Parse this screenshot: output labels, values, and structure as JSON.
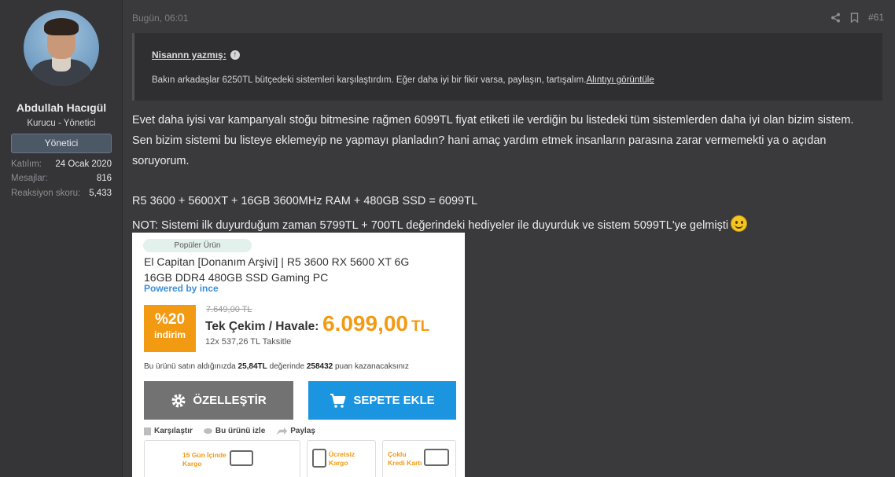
{
  "user": {
    "name": "Abdullah Hacıgül",
    "title": "Kurucu - Yönetici",
    "banner": "Yönetici",
    "stats": [
      {
        "label": "Katılım:",
        "value": "24 Ocak 2020"
      },
      {
        "label": "Mesajlar:",
        "value": "816"
      },
      {
        "label": "Reaksiyon skoru:",
        "value": "5,433"
      }
    ]
  },
  "post": {
    "time": "Bugün, 06:01",
    "number": "#61",
    "quote": {
      "author": "Nisannn yazmış:",
      "text": "Bakın arkadaşlar 6250TL bütçedeki sistemleri karşılaştırdım. Eğer daha iyi bir fikir varsa, paylaşın, tartışalım.",
      "link": "Alıntıyı görüntüle"
    },
    "lines": [
      "Evet daha iyisi var kampanyalı stoğu bitmesine rağmen 6099TL fiyat etiketi ile verdiğin bu listedeki tüm sistemlerden daha iyi olan bizim sistem.",
      "Sen bizim sistemi bu listeye eklemeyip ne yapmayı planladın? hani amaç yardım etmek insanların parasına zarar vermemekti ya o açıdan",
      "soruyorum.",
      "R5 3600 + 5600XT + 16GB 3600MHz RAM + 480GB SSD = 6099TL",
      "NOT: Sistemi ilk duyurduğum zaman 5799TL + 700TL değerindeki hediyeler ile duyurduk ve sistem 5099TL'ye gelmişti"
    ]
  },
  "product": {
    "pill": "Popüler Ürün",
    "title_line1": "El Capitan [Donanım Arşivi] | R5 3600 RX 5600 XT 6G",
    "title_line2": "16GB DDR4 480GB SSD Gaming PC",
    "powered": "Powered by ince",
    "discount_pct": "%20",
    "discount_label": "indirim",
    "old_price": "7.649,00 TL",
    "pay_type": "Tek Çekim / Havale:",
    "price": "6.099,00",
    "currency": "TL",
    "installment": "12x 537,26 TL Taksitle",
    "points_pre": "Bu ürünü satın aldığınızda",
    "points_amount": "25,84TL",
    "points_mid": "değerinde",
    "points_value": "258432",
    "points_post": "puan kazanacaksınız",
    "btn_customize": "ÖZELLEŞTİR",
    "btn_cart": "SEPETE EKLE",
    "tool_compare": "Karşılaştır",
    "tool_watch": "Bu ürünü izle",
    "tool_share": "Paylaş",
    "feat_cargo_days_1": "15 Gün İçinde",
    "feat_cargo_days_2": "Kargo",
    "feat_free_1": "Ücretsiz",
    "feat_free_2": "Kargo",
    "feat_multi_1": "Çoklu",
    "feat_multi_2": "Kredi Kartı"
  },
  "colors": {
    "accent": "#f39a13",
    "cart": "#1b95e0",
    "powered": "#3b8fd8"
  }
}
